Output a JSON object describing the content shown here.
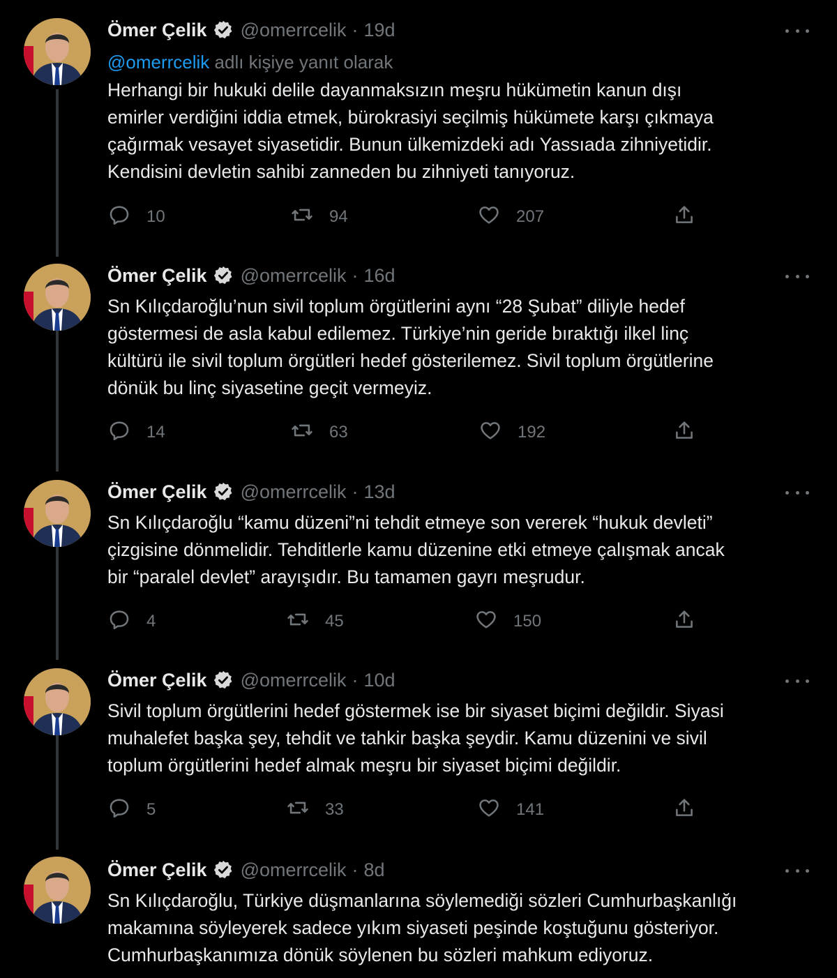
{
  "tweets": [
    {
      "name": "Ömer Çelik",
      "handle": "@omerrcelik",
      "separator": "·",
      "time": "19d",
      "reply_prefix": "@omerrcelik",
      "reply_suffix": " adlı kişiye yanıt olarak",
      "text": "Herhangi bir hukuki delile dayanmaksızın meşru hükümetin kanun dışı\nemirler verdiğini iddia etmek, bürokrasiyi seçilmiş hükümete karşı çıkmaya\nçağırmak vesayet siyasetidir. Bunun ülkemizdeki adı Yassıada zihniyetidir.\nKendisini devletin sahibi zanneden bu zihniyeti tanıyoruz.",
      "replies": "10",
      "retweets": "94",
      "likes": "207"
    },
    {
      "name": "Ömer Çelik",
      "handle": "@omerrcelik",
      "separator": "·",
      "time": "16d",
      "text": "Sn Kılıçdaroğlu’nun sivil toplum örgütlerini aynı “28 Şubat” diliyle hedef\ngöstermesi de asla kabul edilemez. Türkiye’nin geride bıraktığı ilkel linç\nkültürü ile sivil toplum örgütleri hedef gösterilemez. Sivil toplum örgütlerine\ndönük bu linç siyasetine geçit vermeyiz.",
      "replies": "14",
      "retweets": "63",
      "likes": "192"
    },
    {
      "name": "Ömer Çelik",
      "handle": "@omerrcelik",
      "separator": "·",
      "time": "13d",
      "text": "Sn Kılıçdaroğlu “kamu düzeni”ni tehdit etmeye son vererek “hukuk devleti”\nçizgisine dönmelidir. Tehditlerle kamu düzenine etki etmeye çalışmak ancak\nbir “paralel devlet” arayışıdır. Bu tamamen gayrı meşrudur.",
      "replies": "4",
      "retweets": "45",
      "likes": "150"
    },
    {
      "name": "Ömer Çelik",
      "handle": "@omerrcelik",
      "separator": "·",
      "time": "10d",
      "text": "Sivil toplum örgütlerini hedef göstermek ise bir siyaset biçimi değildir. Siyasi\nmuhalefet başka şey, tehdit ve tahkir başka şeydir. Kamu düzenini ve sivil\ntoplum örgütlerini hedef almak meşru bir siyaset biçimi değildir.",
      "replies": "5",
      "retweets": "33",
      "likes": "141"
    },
    {
      "name": "Ömer Çelik",
      "handle": "@omerrcelik",
      "separator": "·",
      "time": "8d",
      "text": "Sn Kılıçdaroğlu, Türkiye düşmanlarına söylemediği sözleri Cumhurbaşkanlığı\nmakamına söyleyerek sadece yıkım siyaseti peşinde koştuğunu gösteriyor.\nCumhurbaşkanımıza dönük söylenen bu sözleri mahkum ediyoruz."
    }
  ],
  "icons": {
    "verified": "verified-badge-icon",
    "more": "more-icon",
    "reply": "reply-icon",
    "retweet": "retweet-icon",
    "like": "like-icon",
    "share": "share-icon"
  },
  "colors": {
    "background": "#000000",
    "text": "#e7e9ea",
    "muted": "#71767b",
    "link": "#1d9bf0",
    "thread_line": "#333639"
  }
}
